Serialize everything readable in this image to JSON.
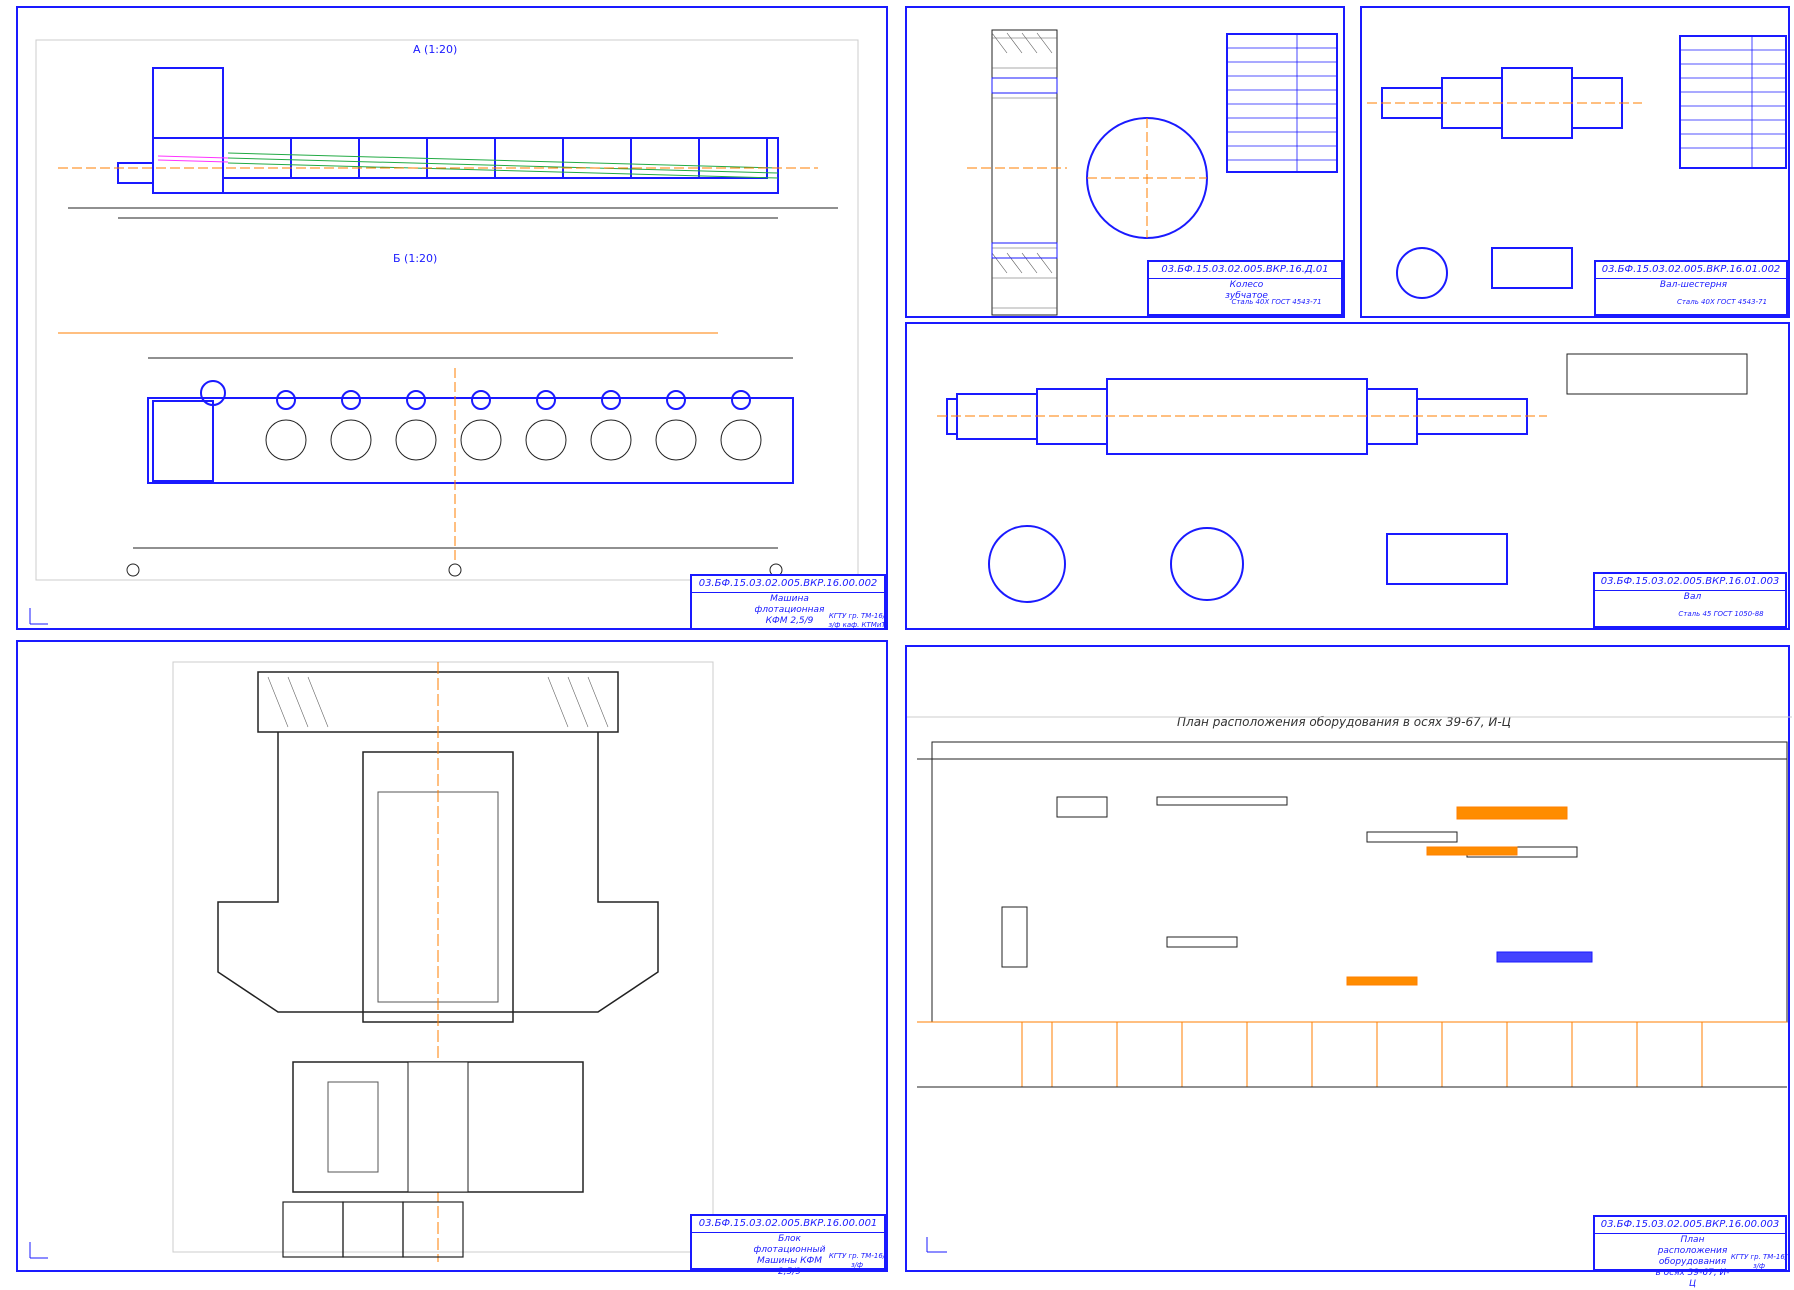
{
  "sheets": {
    "machine": {
      "view_a": "А (1:20)",
      "view_b": "Б (1:20)",
      "title_block": {
        "code": "03.БФ.15.03.02.005.ВКР.16.00.002",
        "name": "Машина флотационная КФМ 2,5/9",
        "org": "КГТУ гр. ТМ-16/з/ф каф. КТМиТ"
      }
    },
    "gear": {
      "title_block": {
        "code": "03.БФ.15.03.02.005.ВКР.16.Д.01",
        "name": "Колесо зубчатое",
        "org": "Сталь 40Х ГОСТ 4543-71"
      }
    },
    "shaft": {
      "title_block": {
        "code": "03.БФ.15.03.02.005.ВКР.16.01.002",
        "name": "Вал-шестерня",
        "org": "Сталь 40Х ГОСТ 4543-71"
      }
    },
    "shaft2": {
      "title_block": {
        "code": "03.БФ.15.03.02.005.ВКР.16.01.003",
        "name": "Вал",
        "org": "Сталь 45 ГОСТ 1050-88"
      }
    },
    "assembly": {
      "title_block": {
        "code": "03.БФ.15.03.02.005.ВКР.16.00.001",
        "name": "Блок флотационный Машины КФМ 2,5/9",
        "org": "КГТУ гр. ТМ-16/з/ф"
      }
    },
    "layout": {
      "header": "План расположения оборудования в осях 39-67, И-Ц",
      "title_block": {
        "code": "03.БФ.15.03.02.005.ВКР.16.00.003",
        "name": "План расположения оборудования в осях 39-67, И-Ц",
        "org": "КГТУ гр. ТМ-16/з/ф"
      }
    }
  },
  "colors": {
    "line": "#1a1aff",
    "axis": "#ff7f00",
    "ink": "#222222",
    "hatch": "#555555"
  }
}
